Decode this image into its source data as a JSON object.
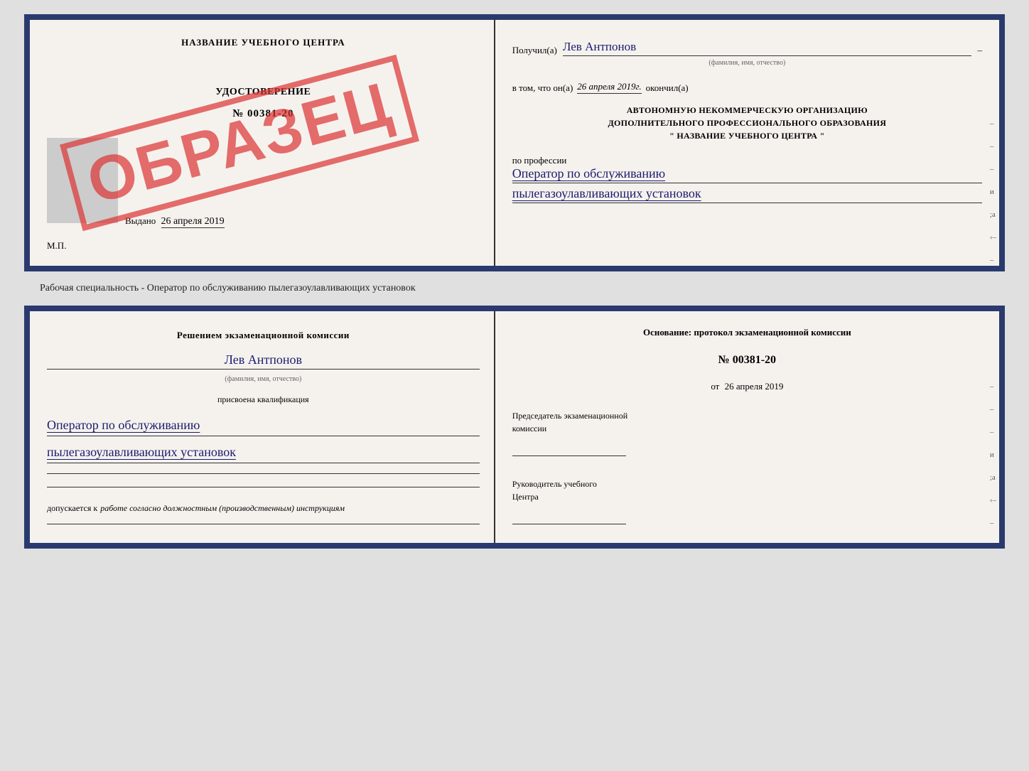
{
  "top_card": {
    "left": {
      "org_name": "НАЗВАНИЕ УЧЕБНОГО ЦЕНТРА",
      "cert_title": "УДОСТОВЕРЕНИЕ",
      "cert_number": "№ 00381-20",
      "issued_label": "Выдано",
      "issued_date": "26 апреля 2019",
      "mp_label": "М.П.",
      "stamp_text": "ОБРАЗЕЦ",
      "photo_alt": "Фото"
    },
    "right": {
      "recipient_label": "Получил(а)",
      "recipient_name": "Лев Антпонов",
      "fio_subtext": "(фамилия, имя, отчество)",
      "date_label": "в том, что он(а)",
      "date_value": "26 апреля 2019г.",
      "finished_label": "окончил(а)",
      "org_line1": "АВТОНОМНУЮ НЕКОММЕРЧЕСКУЮ ОРГАНИЗАЦИЮ",
      "org_line2": "ДОПОЛНИТЕЛЬНОГО ПРОФЕССИОНАЛЬНОГО ОБРАЗОВАНИЯ",
      "org_line3": "\"   НАЗВАНИЕ УЧЕБНОГО ЦЕНТРА   \"",
      "profession_label": "по профессии",
      "profession_line1": "Оператор по обслуживанию",
      "profession_line2": "пылегазоулавливающих установок",
      "side_marks": [
        "–",
        "–",
        "–",
        "и",
        ";а",
        "‹–",
        "–",
        "–",
        "–"
      ]
    }
  },
  "middle_text": "Рабочая специальность - Оператор по обслуживанию пылегазоулавливающих установок",
  "bottom_card": {
    "left": {
      "commission_line1": "Решением экзаменационной комиссии",
      "person_name": "Лев Антпонов",
      "fio_subtext": "(фамилия, имя, отчество)",
      "assign_label": "присвоена квалификация",
      "qualification_line1": "Оператор по обслуживанию",
      "qualification_line2": "пылегазоулавливающих установок",
      "allow_text": "допускается к",
      "allow_italic": "работе согласно должностным (производственным) инструкциям"
    },
    "right": {
      "basis_label": "Основание: протокол экзаменационной комиссии",
      "protocol_number": "№  00381-20",
      "date_prefix": "от",
      "protocol_date": "26 апреля 2019",
      "chairman_label": "Председатель экзаменационной",
      "chairman_label2": "комиссии",
      "director_label": "Руководитель учебного",
      "director_label2": "Центра",
      "side_marks": [
        "–",
        "–",
        "–",
        "и",
        ";а",
        "‹–",
        "–",
        "–",
        "–"
      ]
    }
  }
}
